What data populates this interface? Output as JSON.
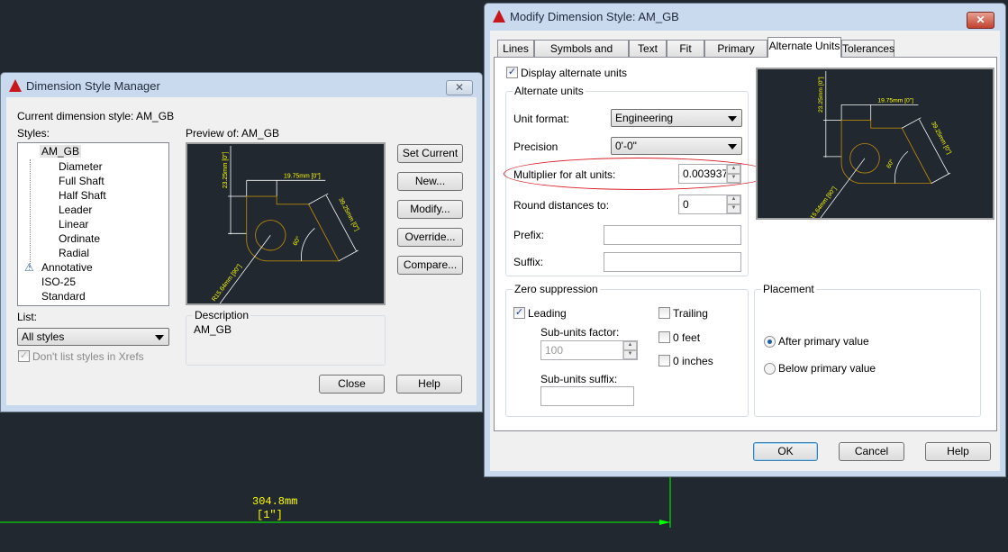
{
  "canvas": {
    "dimension_text": "304.8mm",
    "dimension_alt_text": "[1\"]",
    "line_color": "#00ff00",
    "text_color": "#ffff00"
  },
  "manager": {
    "title": "Dimension Style Manager",
    "current_style_label": "Current dimension style: AM_GB",
    "styles_label": "Styles:",
    "styles": [
      "AM_GB",
      "Diameter",
      "Full Shaft",
      "Half Shaft",
      "Leader",
      "Linear",
      "Ordinate",
      "Radial",
      "Annotative",
      "ISO-25",
      "Standard"
    ],
    "preview_label": "Preview of: AM_GB",
    "list_label": "List:",
    "list_value": "All styles",
    "dont_list_xrefs": "Don't list styles in Xrefs",
    "description_label": "Description",
    "description_value": "AM_GB",
    "buttons": {
      "set_current": "Set Current",
      "new": "New...",
      "modify": "Modify...",
      "override": "Override...",
      "compare": "Compare...",
      "close": "Close",
      "help": "Help"
    }
  },
  "preview": {
    "v": "23.25mm [0\"]",
    "h": "19.75mm [0\"]",
    "a": "39.25mm [0\"]",
    "ang": "60°",
    "r": "R15.64mm [90\"]"
  },
  "modify": {
    "title": "Modify Dimension Style: AM_GB",
    "tabs": [
      "Lines",
      "Symbols and Arrows",
      "Text",
      "Fit",
      "Primary Units",
      "Alternate Units",
      "Tolerances"
    ],
    "active_tab": "Alternate Units",
    "display_alt_units": {
      "label": "Display alternate units",
      "checked": true
    },
    "alt_group": "Alternate units",
    "unit_format_label": "Unit format:",
    "unit_format": "Engineering",
    "precision_label": "Precision",
    "precision": "0'-0\"",
    "multiplier_label": "Multiplier for alt units:",
    "multiplier": "0.003937",
    "round_label": "Round distances  to:",
    "round": "0",
    "prefix_label": "Prefix:",
    "prefix": "",
    "suffix_label": "Suffix:",
    "suffix": "",
    "zero_group": "Zero suppression",
    "leading": {
      "label": "Leading",
      "checked": true
    },
    "subunits_factor_label": "Sub-units factor:",
    "subunits_factor": "100",
    "subunits_suffix_label": "Sub-units suffix:",
    "subunits_suffix": "",
    "trailing": {
      "label": "Trailing",
      "checked": false
    },
    "zero_feet": {
      "label": "0 feet",
      "checked": false
    },
    "zero_inches": {
      "label": "0 inches",
      "checked": false
    },
    "placement_group": "Placement",
    "after_primary": {
      "label": "After primary value",
      "selected": true
    },
    "below_primary": {
      "label": "Below primary value",
      "selected": false
    },
    "buttons": {
      "ok": "OK",
      "cancel": "Cancel",
      "help": "Help"
    },
    "highlight_color": "#d81e28"
  }
}
